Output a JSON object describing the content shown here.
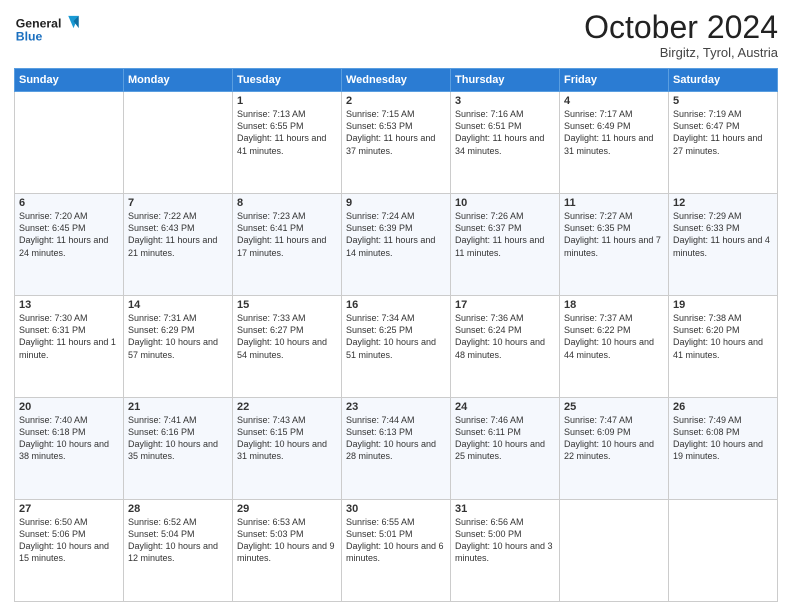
{
  "header": {
    "logo_line1": "General",
    "logo_line2": "Blue",
    "month": "October 2024",
    "location": "Birgitz, Tyrol, Austria"
  },
  "weekdays": [
    "Sunday",
    "Monday",
    "Tuesday",
    "Wednesday",
    "Thursday",
    "Friday",
    "Saturday"
  ],
  "weeks": [
    [
      {
        "day": "",
        "text": ""
      },
      {
        "day": "",
        "text": ""
      },
      {
        "day": "1",
        "text": "Sunrise: 7:13 AM\nSunset: 6:55 PM\nDaylight: 11 hours and 41 minutes."
      },
      {
        "day": "2",
        "text": "Sunrise: 7:15 AM\nSunset: 6:53 PM\nDaylight: 11 hours and 37 minutes."
      },
      {
        "day": "3",
        "text": "Sunrise: 7:16 AM\nSunset: 6:51 PM\nDaylight: 11 hours and 34 minutes."
      },
      {
        "day": "4",
        "text": "Sunrise: 7:17 AM\nSunset: 6:49 PM\nDaylight: 11 hours and 31 minutes."
      },
      {
        "day": "5",
        "text": "Sunrise: 7:19 AM\nSunset: 6:47 PM\nDaylight: 11 hours and 27 minutes."
      }
    ],
    [
      {
        "day": "6",
        "text": "Sunrise: 7:20 AM\nSunset: 6:45 PM\nDaylight: 11 hours and 24 minutes."
      },
      {
        "day": "7",
        "text": "Sunrise: 7:22 AM\nSunset: 6:43 PM\nDaylight: 11 hours and 21 minutes."
      },
      {
        "day": "8",
        "text": "Sunrise: 7:23 AM\nSunset: 6:41 PM\nDaylight: 11 hours and 17 minutes."
      },
      {
        "day": "9",
        "text": "Sunrise: 7:24 AM\nSunset: 6:39 PM\nDaylight: 11 hours and 14 minutes."
      },
      {
        "day": "10",
        "text": "Sunrise: 7:26 AM\nSunset: 6:37 PM\nDaylight: 11 hours and 11 minutes."
      },
      {
        "day": "11",
        "text": "Sunrise: 7:27 AM\nSunset: 6:35 PM\nDaylight: 11 hours and 7 minutes."
      },
      {
        "day": "12",
        "text": "Sunrise: 7:29 AM\nSunset: 6:33 PM\nDaylight: 11 hours and 4 minutes."
      }
    ],
    [
      {
        "day": "13",
        "text": "Sunrise: 7:30 AM\nSunset: 6:31 PM\nDaylight: 11 hours and 1 minute."
      },
      {
        "day": "14",
        "text": "Sunrise: 7:31 AM\nSunset: 6:29 PM\nDaylight: 10 hours and 57 minutes."
      },
      {
        "day": "15",
        "text": "Sunrise: 7:33 AM\nSunset: 6:27 PM\nDaylight: 10 hours and 54 minutes."
      },
      {
        "day": "16",
        "text": "Sunrise: 7:34 AM\nSunset: 6:25 PM\nDaylight: 10 hours and 51 minutes."
      },
      {
        "day": "17",
        "text": "Sunrise: 7:36 AM\nSunset: 6:24 PM\nDaylight: 10 hours and 48 minutes."
      },
      {
        "day": "18",
        "text": "Sunrise: 7:37 AM\nSunset: 6:22 PM\nDaylight: 10 hours and 44 minutes."
      },
      {
        "day": "19",
        "text": "Sunrise: 7:38 AM\nSunset: 6:20 PM\nDaylight: 10 hours and 41 minutes."
      }
    ],
    [
      {
        "day": "20",
        "text": "Sunrise: 7:40 AM\nSunset: 6:18 PM\nDaylight: 10 hours and 38 minutes."
      },
      {
        "day": "21",
        "text": "Sunrise: 7:41 AM\nSunset: 6:16 PM\nDaylight: 10 hours and 35 minutes."
      },
      {
        "day": "22",
        "text": "Sunrise: 7:43 AM\nSunset: 6:15 PM\nDaylight: 10 hours and 31 minutes."
      },
      {
        "day": "23",
        "text": "Sunrise: 7:44 AM\nSunset: 6:13 PM\nDaylight: 10 hours and 28 minutes."
      },
      {
        "day": "24",
        "text": "Sunrise: 7:46 AM\nSunset: 6:11 PM\nDaylight: 10 hours and 25 minutes."
      },
      {
        "day": "25",
        "text": "Sunrise: 7:47 AM\nSunset: 6:09 PM\nDaylight: 10 hours and 22 minutes."
      },
      {
        "day": "26",
        "text": "Sunrise: 7:49 AM\nSunset: 6:08 PM\nDaylight: 10 hours and 19 minutes."
      }
    ],
    [
      {
        "day": "27",
        "text": "Sunrise: 6:50 AM\nSunset: 5:06 PM\nDaylight: 10 hours and 15 minutes."
      },
      {
        "day": "28",
        "text": "Sunrise: 6:52 AM\nSunset: 5:04 PM\nDaylight: 10 hours and 12 minutes."
      },
      {
        "day": "29",
        "text": "Sunrise: 6:53 AM\nSunset: 5:03 PM\nDaylight: 10 hours and 9 minutes."
      },
      {
        "day": "30",
        "text": "Sunrise: 6:55 AM\nSunset: 5:01 PM\nDaylight: 10 hours and 6 minutes."
      },
      {
        "day": "31",
        "text": "Sunrise: 6:56 AM\nSunset: 5:00 PM\nDaylight: 10 hours and 3 minutes."
      },
      {
        "day": "",
        "text": ""
      },
      {
        "day": "",
        "text": ""
      }
    ]
  ]
}
